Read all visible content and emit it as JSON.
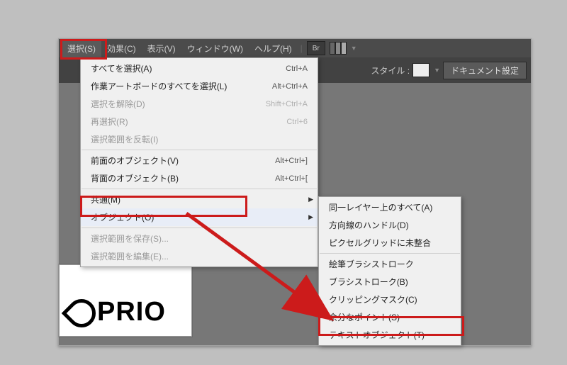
{
  "menubar": {
    "select": "選択(S)",
    "effect": "効果(C)",
    "view": "表示(V)",
    "window": "ウィンドウ(W)",
    "help": "ヘルプ(H)",
    "br": "Br"
  },
  "optionsbar": {
    "style_label": "スタイル :",
    "doc_setup": "ドキュメント設定"
  },
  "dropdown": {
    "all": "すべてを選択(A)",
    "all_k": "Ctrl+A",
    "allArtboard": "作業アートボードのすべてを選択(L)",
    "allArtboard_k": "Alt+Ctrl+A",
    "deselect": "選択を解除(D)",
    "deselect_k": "Shift+Ctrl+A",
    "reselect": "再選択(R)",
    "reselect_k": "Ctrl+6",
    "inverse": "選択範囲を反転(I)",
    "nextAbove": "前面のオブジェクト(V)",
    "nextAbove_k": "Alt+Ctrl+]",
    "nextBelow": "背面のオブジェクト(B)",
    "nextBelow_k": "Alt+Ctrl+[",
    "same": "共通(M)",
    "object": "オブジェクト(O)",
    "save": "選択範囲を保存(S)...",
    "edit": "選択範囲を編集(E)..."
  },
  "submenu": {
    "sameLayer": "同一レイヤー上のすべて(A)",
    "dirHandles": "方向線のハンドル(D)",
    "pixelGrid": "ピクセルグリッドに未整合",
    "bristle": "絵筆ブラシストローク",
    "brush": "ブラシストローク(B)",
    "clip": "クリッピングマスク(C)",
    "stray": "余分なポイント(S)",
    "textObj": "テキストオブジェクト(T)"
  },
  "canvas": {
    "logo": "PRIO"
  }
}
